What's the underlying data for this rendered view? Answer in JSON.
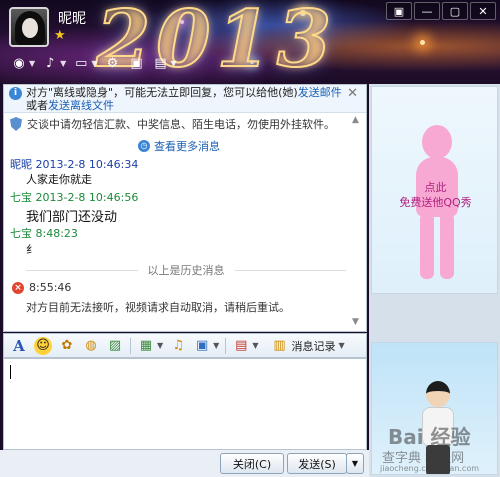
{
  "header": {
    "nickname": "昵昵",
    "year_art": "2013",
    "window_buttons": [
      "▣",
      "—",
      "▢",
      "✕"
    ],
    "tools": [
      {
        "icon": "camera-icon",
        "glyph": "◉"
      },
      {
        "icon": "mic-icon",
        "glyph": "♪"
      },
      {
        "icon": "folder-transfer-icon",
        "glyph": "▭"
      },
      {
        "icon": "remote-assist-icon",
        "glyph": "⚙"
      },
      {
        "icon": "screen-share-icon",
        "glyph": "▣"
      },
      {
        "icon": "apps-icon",
        "glyph": "▤"
      }
    ]
  },
  "chat": {
    "notice_prefix": "对方\"离线或隐身\"，可能无法立即回复，您可以给他(她)",
    "notice_link1": "发送邮件",
    "notice_mid": "或者",
    "notice_link2": "发送离线文件",
    "safety_text": "交谈中请勿轻信汇款、中奖信息、陌生电话，勿使用外挂软件。",
    "more_history": "查看更多消息",
    "messages": [
      {
        "sender": "昵昵",
        "time": "2013-2-8 10:46:34",
        "text": "人家走你就走"
      },
      {
        "sender": "七宝",
        "time": "2013-2-8 10:46:56",
        "text": "我们部门还没动"
      },
      {
        "sender": "七宝",
        "time": "8:48:23",
        "text": "纟"
      }
    ],
    "divider": "以上是历史消息",
    "error_time": "8:55:46",
    "error_text": "对方目前无法接听，视频请求自动取消，请稍后重试。"
  },
  "format_toolbar": {
    "history_label": "消息记录"
  },
  "buttons": {
    "close": "关闭(C)",
    "send": "发送(S)"
  },
  "side": {
    "show_line1": "点此",
    "show_line2": "免费送他QQ秀",
    "watermark1": "Bai 经验",
    "watermark2": "查字典 教程网",
    "watermark3": "jiaocheng.chazidian.com"
  }
}
